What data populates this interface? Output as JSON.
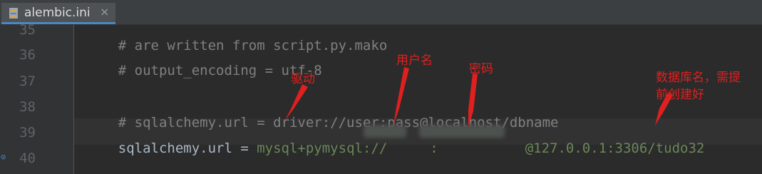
{
  "tab": {
    "title": "alembic.ini",
    "icon": "ini-file-icon",
    "close": "×"
  },
  "colors": {
    "background": "#2b2b2b",
    "gutter": "#313335",
    "caret_line": "#323232",
    "comment": "#808080",
    "key": "#a9b7c6",
    "value": "#6a8759",
    "annotation": "#e0201f"
  },
  "lines": [
    {
      "number": "35",
      "comment": "# are written from script.py.mako"
    },
    {
      "number": "36",
      "comment": "# output_encoding = utf-8"
    },
    {
      "number": "37"
    },
    {
      "number": "38",
      "comment": "# sqlalchemy.url = driver://user:pass@localhost/dbname"
    },
    {
      "number": "39",
      "key": "sqlalchemy.url = ",
      "value_prefix": "mysql+pymysql://",
      "separator": ":",
      "value_suffix": "@127.0.0.1:3306/tudo32",
      "redacted": [
        "username",
        "password"
      ]
    },
    {
      "number": "40"
    }
  ],
  "annotations": {
    "driver": "驱动",
    "username": "用户名",
    "password": "密码",
    "database": "数据库名，需提\n前创建好"
  }
}
